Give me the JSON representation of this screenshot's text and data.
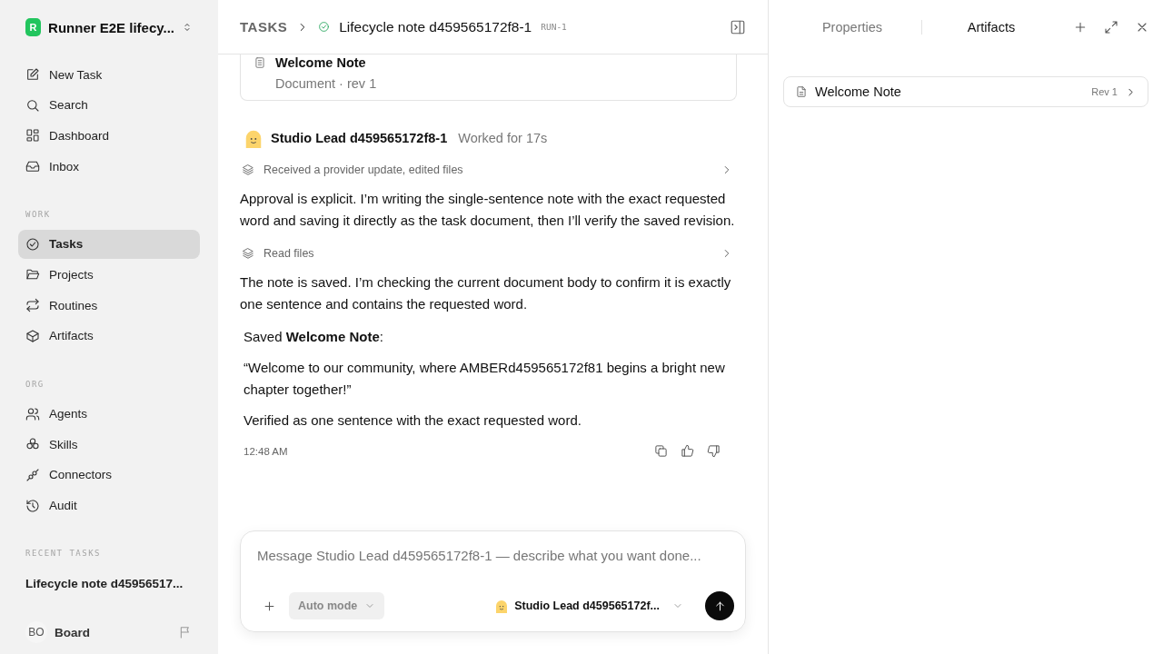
{
  "workspace": {
    "name": "Runner E2E lifecy...",
    "initial": "R"
  },
  "nav": [
    {
      "label": "New Task",
      "selected": false
    },
    {
      "label": "Search",
      "selected": false
    },
    {
      "label": "Dashboard",
      "selected": false
    },
    {
      "label": "Inbox",
      "selected": false
    }
  ],
  "sections": [
    {
      "title": "WORK",
      "items": [
        {
          "label": "Tasks",
          "selected": true
        },
        {
          "label": "Projects",
          "selected": false
        },
        {
          "label": "Routines",
          "selected": false
        },
        {
          "label": "Artifacts",
          "selected": false
        }
      ]
    },
    {
      "title": "ORG",
      "items": [
        {
          "label": "Agents",
          "selected": false
        },
        {
          "label": "Skills",
          "selected": false
        },
        {
          "label": "Connectors",
          "selected": false
        },
        {
          "label": "Audit",
          "selected": false
        }
      ]
    }
  ],
  "recent": {
    "title": "RECENT TASKS",
    "items": [
      "Lifecycle note d45956517..."
    ]
  },
  "user": {
    "initials": "BO",
    "name": "Board"
  },
  "breadcrumb": {
    "root": "TASKS",
    "title": "Lifecycle note d459565172f8-1",
    "tag": "RUN-1"
  },
  "doc_card": {
    "title": "Welcome Note",
    "meta": "Document · rev 1"
  },
  "message": {
    "author": "Studio Lead d459565172f8-1",
    "duration": "Worked for 17s",
    "time": "12:48 AM",
    "blocks": [
      {
        "kind": "activity",
        "text": "Received a provider update, edited files"
      },
      {
        "kind": "text",
        "text": "Approval is explicit. I’m writing the single-sentence note with the exact requested word and saving it directly as the task document, then I’ll verify the saved revision."
      },
      {
        "kind": "activity",
        "text": "Read files"
      },
      {
        "kind": "text",
        "text": "The note is saved. I’m checking the current document body to confirm it is exactly one sentence and contains the requested word."
      },
      {
        "kind": "quote",
        "text": "Saved **Welcome Note**:"
      },
      {
        "kind": "quote",
        "text": "“Welcome to our community, where AMBERd459565172f81 begins a bright new chapter together!”"
      },
      {
        "kind": "quote",
        "text": "Verified as one sentence with the exact requested word."
      }
    ]
  },
  "composer": {
    "placeholder": "Message Studio Lead d459565172f8-1 — describe what you want done...",
    "mode": "Auto mode",
    "agent": "Studio Lead d459565172f..."
  },
  "panel": {
    "tabs": [
      {
        "label": "Properties",
        "selected": false
      },
      {
        "label": "Artifacts",
        "selected": true
      }
    ],
    "artifacts": [
      {
        "title": "Welcome Note",
        "rev": "Rev 1"
      }
    ]
  }
}
